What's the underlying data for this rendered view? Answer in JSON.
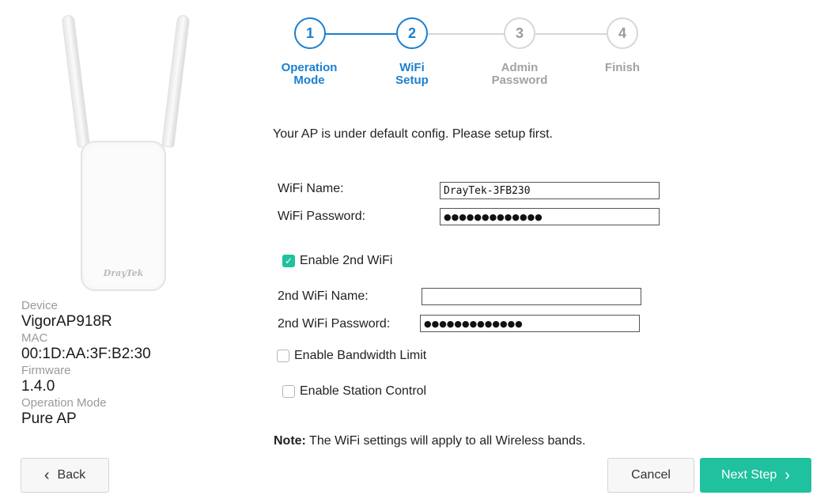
{
  "device": {
    "logo": "DrayTek",
    "fields": [
      {
        "label": "Device",
        "value": "VigorAP918R"
      },
      {
        "label": "MAC",
        "value": "00:1D:AA:3F:B2:30"
      },
      {
        "label": "Firmware",
        "value": "1.4.0"
      },
      {
        "label": "Operation Mode",
        "value": "Pure AP"
      }
    ]
  },
  "stepper": {
    "steps": [
      {
        "number": "1",
        "label_line1": "Operation",
        "label_line2": "Mode",
        "state": "done"
      },
      {
        "number": "2",
        "label_line1": "WiFi",
        "label_line2": "Setup",
        "state": "current"
      },
      {
        "number": "3",
        "label_line1": "Admin",
        "label_line2": "Password",
        "state": "pending"
      },
      {
        "number": "4",
        "label_line1": "Finish",
        "label_line2": "",
        "state": "pending"
      }
    ],
    "colors": {
      "active": "#1b7fcf",
      "inactive": "#d7d7d7"
    }
  },
  "form": {
    "intro": "Your AP is under default config. Please setup first.",
    "wifi_name_label": "WiFi Name:",
    "wifi_name_value": "DrayTek-3FB230",
    "wifi_password_label": "WiFi Password:",
    "wifi_password_value": "●●●●●●●●●●●●●",
    "enable_2nd_wifi_label": "Enable 2nd WiFi",
    "enable_2nd_wifi_checked": true,
    "second_wifi_name_label": "2nd WiFi Name:",
    "second_wifi_name_value": "",
    "second_wifi_password_label": "2nd WiFi Password:",
    "second_wifi_password_value": "●●●●●●●●●●●●●",
    "bandwidth_limit_label": "Enable Bandwidth Limit",
    "bandwidth_limit_checked": false,
    "station_control_label": "Enable Station Control",
    "station_control_checked": false,
    "note_prefix": "Note:",
    "note_text": " The WiFi settings will apply to all Wireless bands."
  },
  "buttons": {
    "back": "Back",
    "cancel": "Cancel",
    "next": "Next Step"
  },
  "colors": {
    "accent": "#1fc19f",
    "step_active": "#1b7fcf"
  },
  "icons": {
    "back": "chevron-left-icon",
    "next": "chevron-right-icon",
    "check": "checkmark-icon"
  }
}
